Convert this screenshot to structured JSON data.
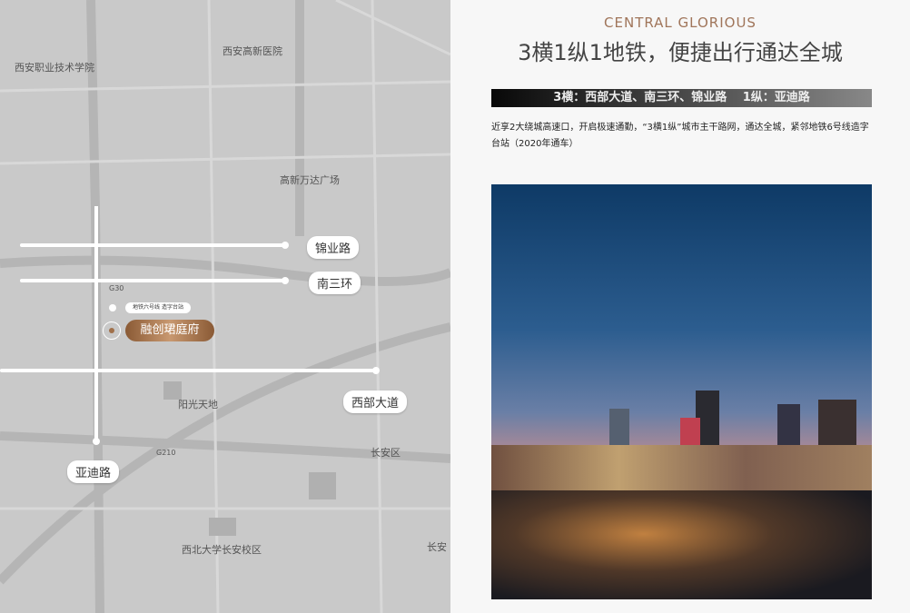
{
  "map": {
    "labels": [
      "西安职业技术学院",
      "西安高新医院",
      "高新万达广场",
      "G30",
      "G210",
      "阳光天地",
      "长安区",
      "西北大学长安校区",
      "长安"
    ],
    "roads": {
      "jinye": "锦业路",
      "nansanhuan": "南三环",
      "xibu": "西部大道",
      "yadi": "亚迪路"
    },
    "metro_label": "地铁六号线 造字台站",
    "project": "融创珺庭府"
  },
  "content": {
    "subtitle": "CENTRAL GLORIOUS",
    "title": "3横1纵1地铁，便捷出行通达全城",
    "bar": "3横：西部大道、南三环、锦业路　 1纵：亚迪路",
    "description": "近享2大绕城高速口，开启极速通勤，“3横1纵”城市主干路网，通达全城，紧邻地铁6号线造字台站（2020年通车）"
  }
}
